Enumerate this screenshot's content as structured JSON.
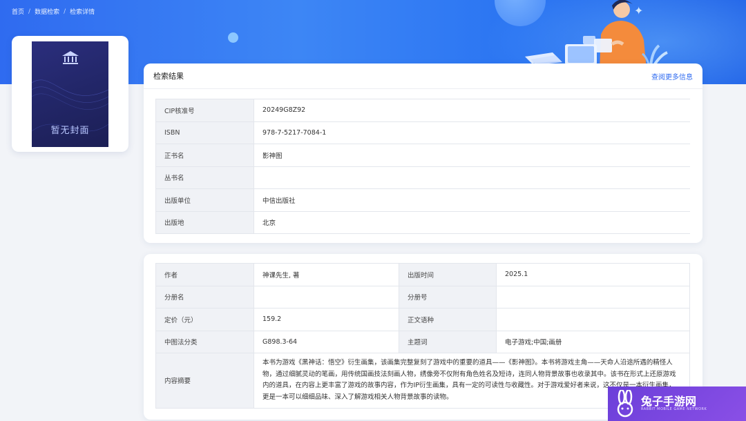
{
  "breadcrumb": [
    "首页",
    "数据检索",
    "检索详情"
  ],
  "cover": {
    "placeholder_text": "暂无封面"
  },
  "result_panel": {
    "title": "检索结果",
    "more_link": "查阅更多信息",
    "rows": [
      {
        "label": "CIP核准号",
        "value": "20249G8Z92"
      },
      {
        "label": "ISBN",
        "value": "978-7-5217-7084-1"
      },
      {
        "label": "正书名",
        "value": "影神图"
      },
      {
        "label": "丛书名",
        "value": ""
      },
      {
        "label": "出版单位",
        "value": "中信出版社"
      },
      {
        "label": "出版地",
        "value": "北京"
      }
    ]
  },
  "detail_panel": {
    "rows": [
      {
        "label": "作者",
        "value": "神课先生, 著",
        "label2": "出版时间",
        "value2": "2025.1"
      },
      {
        "label": "分册名",
        "value": "",
        "label2": "分册号",
        "value2": ""
      },
      {
        "label": "定价（元）",
        "value": "159.2",
        "label2": "正文语种",
        "value2": ""
      },
      {
        "label": "中图法分类",
        "value": "G898.3-64",
        "label2": "主题词",
        "value2": "电子游戏;中国;画册"
      }
    ],
    "abstract_label": "内容摘要",
    "abstract": "本书为游戏《黑神话：悟空》衍生画集，该画集完整复刻了游戏中的重要的道具——《影神图》。本书将游戏主角——天命人沿途所遇的精怪人物，通过细腻灵动的笔画，用传统国画技法刻画人物，绣像旁不仅附有角色姓名及短诗，连同人物背景故事也收录其中。该书在形式上还原游戏内的道具，在内容上更丰富了游戏的故事内容，作为IP衍生画集，具有一定的可读性与收藏性。对于游戏爱好者来说，这不仅是一本衍生画集，更是一本可以细细品味、深入了解游戏相关人物背景故事的读物。"
  },
  "watermark": {
    "title": "兔子手游网",
    "subtitle": "RABBIT MOBILE GAME NETWORK"
  },
  "colors": {
    "accent": "#2f6bf0",
    "label_bg": "#f0f2f6"
  }
}
